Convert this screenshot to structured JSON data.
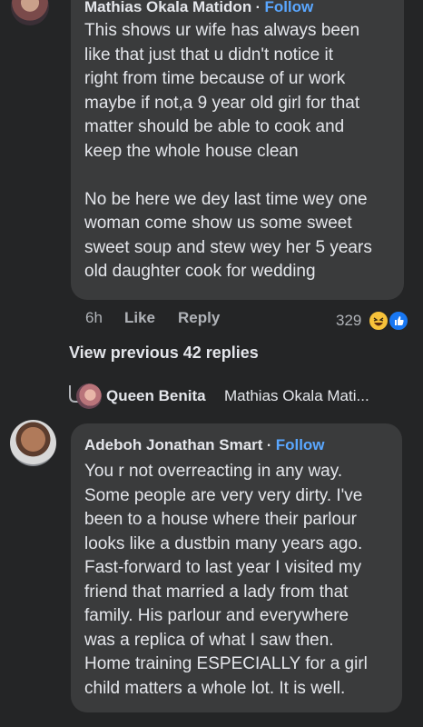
{
  "comment1": {
    "author": "Mathias Okala Matidon",
    "separator": "·",
    "follow_label": "Follow",
    "paragraph1_lines": [
      "This shows ur wife has always been",
      "like that just that u didn't notice it",
      "right from time because of ur work",
      "maybe if not,a 9 year old girl for that",
      "matter should be able to cook and",
      "keep the whole house clean"
    ],
    "paragraph2_lines": [
      "No be here we dey last time wey one",
      "woman come show us some sweet",
      "sweet soup and stew wey her 5 years",
      "old daughter cook for wedding"
    ],
    "time": "6h",
    "like_label": "Like",
    "reply_label": "Reply",
    "reaction_count": "329",
    "reaction_icons": [
      "haha-emoji-icon",
      "like-reaction-icon"
    ]
  },
  "view_previous": "View previous 42 replies",
  "reply_preview": {
    "author": "Queen Benita",
    "text": "Mathias Okala Mati..."
  },
  "comment2": {
    "author": "Adeboh Jonathan Smart",
    "separator": "·",
    "follow_label": "Follow",
    "lines": [
      "You r not overreacting in any way.",
      "Some people are very very dirty. I've",
      "been to a house where their parlour",
      "looks like a dustbin many years ago.",
      "Fast-forward to last year I visited my",
      "friend that married a lady from that",
      "family. His parlour and everywhere",
      "was a replica of what I saw then.",
      "Home training ESPECIALLY for a girl",
      "child matters a whole lot. It is well."
    ]
  },
  "colors": {
    "background": "#242526",
    "bubble": "#3a3b3c",
    "follow": "#5aa7ff",
    "muted": "#b0b3b8"
  }
}
